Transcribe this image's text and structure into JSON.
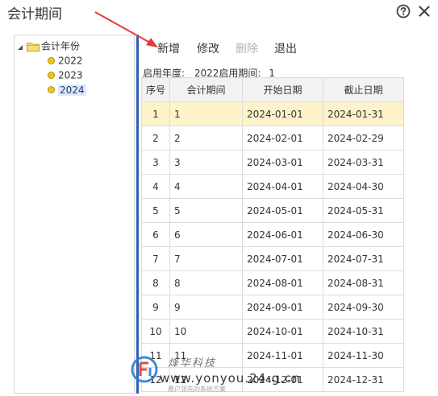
{
  "window": {
    "title": "会计期间",
    "help_icon": "question-circle-icon",
    "close_icon": "close-icon"
  },
  "tree": {
    "root": {
      "label": "会计年份",
      "icon": "folder-icon",
      "expanded": true
    },
    "years": [
      {
        "label": "2022",
        "icon": "dot-icon",
        "selected": false
      },
      {
        "label": "2023",
        "icon": "dot-icon",
        "selected": false
      },
      {
        "label": "2024",
        "icon": "dot-icon",
        "selected": true
      }
    ]
  },
  "toolbar": {
    "add_label": "新增",
    "edit_label": "修改",
    "delete_label": "删除",
    "exit_label": "退出"
  },
  "info": {
    "start_year_label": "启用年度:",
    "start_year_value": "2022",
    "start_period_label": "启用期间:",
    "start_period_value": "1"
  },
  "table": {
    "headers": [
      "序号",
      "会计期间",
      "开始日期",
      "截止日期"
    ],
    "rows": [
      [
        "1",
        "1",
        "2024-01-01",
        "2024-01-31"
      ],
      [
        "2",
        "2",
        "2024-02-01",
        "2024-02-29"
      ],
      [
        "3",
        "3",
        "2024-03-01",
        "2024-03-31"
      ],
      [
        "4",
        "4",
        "2024-04-01",
        "2024-04-30"
      ],
      [
        "5",
        "5",
        "2024-05-01",
        "2024-05-31"
      ],
      [
        "6",
        "6",
        "2024-06-01",
        "2024-06-30"
      ],
      [
        "7",
        "7",
        "2024-07-01",
        "2024-07-31"
      ],
      [
        "8",
        "8",
        "2024-08-01",
        "2024-08-31"
      ],
      [
        "9",
        "9",
        "2024-09-01",
        "2024-09-30"
      ],
      [
        "10",
        "10",
        "2024-10-01",
        "2024-10-31"
      ],
      [
        "11",
        "11",
        "2024-11-01",
        "2024-11-30"
      ],
      [
        "12",
        "12",
        "2024-12-01",
        "2024-12-31"
      ]
    ],
    "selected_row": 0
  },
  "colors": {
    "accent": "#2d5fb3",
    "selected_row_bg": "#fdf2c9",
    "arrow": "#e53935"
  },
  "watermark": {
    "brand": "烽华科技",
    "url": "www.yonyou.24-g.cn",
    "tagline": "用户领先的系统方案"
  }
}
